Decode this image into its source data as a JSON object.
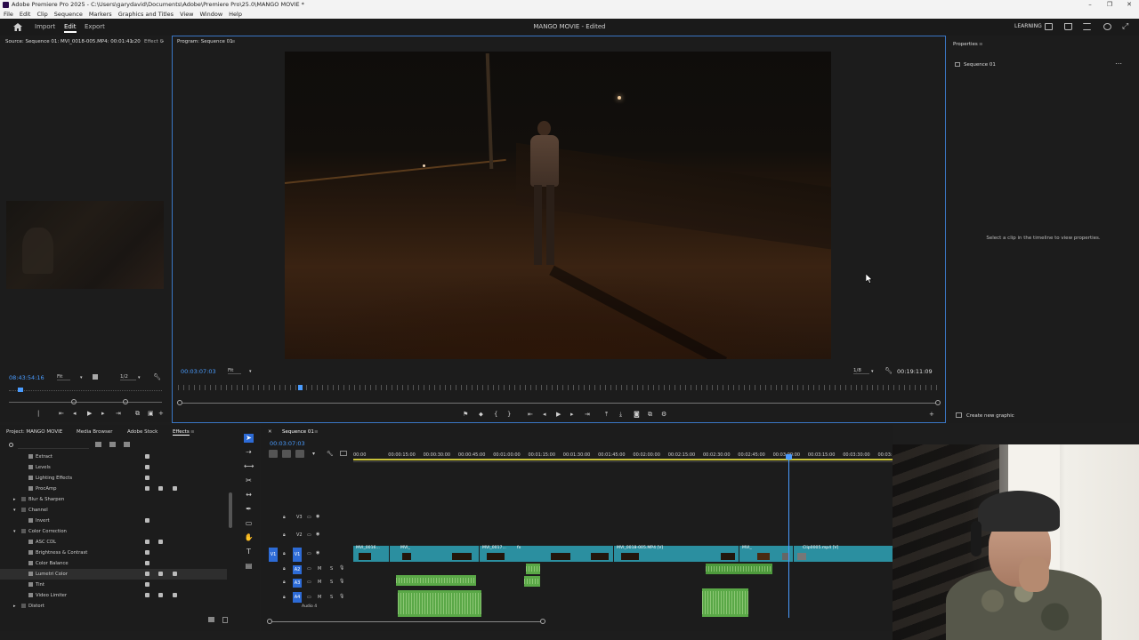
{
  "app": {
    "window_title": "Adobe Premiere Pro 2025 - C:\\Users\\garydavid\\Documents\\Adobe\\Premiere Pro\\25.0\\MANGO MOVIE *",
    "menus": [
      "File",
      "Edit",
      "Clip",
      "Sequence",
      "Markers",
      "Graphics and Titles",
      "View",
      "Window",
      "Help"
    ]
  },
  "header": {
    "tabs": [
      "Import",
      "Edit",
      "Export"
    ],
    "active_tab": "Edit",
    "project_title": "MANGO MOVIE - Edited",
    "workspace_label": "LEARNING"
  },
  "source": {
    "tab_label": "Source: Sequence 01: MVI_0018-005.MP4: 00:01:41:20",
    "tab2_label": "Effect C",
    "timecode": "08:43:54:16",
    "fit": "Fit",
    "resolution": "1/2"
  },
  "program": {
    "tab_label": "Program: Sequence 01",
    "timecode": "00:03:07:03",
    "fit": "Fit",
    "resolution": "1/8",
    "duration": "00:19:11:09"
  },
  "properties": {
    "tab_label": "Properties",
    "sequence": "Sequence 01",
    "hint": "Select a clip in the timeline to view properties.",
    "create_graphic": "Create new graphic"
  },
  "project_panel": {
    "tabs": [
      "Project: MANGO MOVIE",
      "Media Browser",
      "Adobe Stock",
      "Effects"
    ],
    "active_tab": "Effects",
    "tree": [
      {
        "label": "Extract",
        "depth": 2,
        "kind": "fx"
      },
      {
        "label": "Levels",
        "depth": 2,
        "kind": "fx"
      },
      {
        "label": "Lighting Effects",
        "depth": 2,
        "kind": "fx"
      },
      {
        "label": "ProcAmp",
        "depth": 2,
        "kind": "fx"
      },
      {
        "label": "Blur & Sharpen",
        "depth": 1,
        "kind": "folder"
      },
      {
        "label": "Channel",
        "depth": 1,
        "kind": "folder"
      },
      {
        "label": "Invert",
        "depth": 2,
        "kind": "fx"
      },
      {
        "label": "Color Correction",
        "depth": 1,
        "kind": "folder"
      },
      {
        "label": "ASC CDL",
        "depth": 2,
        "kind": "fx"
      },
      {
        "label": "Brightness & Contrast",
        "depth": 2,
        "kind": "fx"
      },
      {
        "label": "Color Balance",
        "depth": 2,
        "kind": "fx"
      },
      {
        "label": "Lumetri Color",
        "depth": 2,
        "kind": "fx",
        "selected": true
      },
      {
        "label": "Tint",
        "depth": 2,
        "kind": "fx"
      },
      {
        "label": "Video Limiter",
        "depth": 2,
        "kind": "fx"
      },
      {
        "label": "Distort",
        "depth": 1,
        "kind": "folder"
      }
    ]
  },
  "timeline": {
    "tab_label": "Sequence 01",
    "timecode": "00:03:07:03",
    "ruler": [
      "00:00",
      "00:00:15:00",
      "00:00:30:00",
      "00:00:45:00",
      "00:01:00:00",
      "00:01:15:00",
      "00:01:30:00",
      "00:01:45:00",
      "00:02:00:00",
      "00:02:15:00",
      "00:02:30:00",
      "00:02:45:00",
      "00:03:00:00",
      "00:03:15:00",
      "00:03:30:00",
      "00:03:45:00"
    ],
    "tracks": {
      "video": [
        "V3",
        "V2",
        "V1"
      ],
      "audio": [
        "A2",
        "A3",
        "A4"
      ],
      "audio_name": "Audio 4",
      "track_toggles": [
        "M",
        "S"
      ]
    },
    "clip_labels": [
      "MVI_0016...",
      "MVI_",
      "MVI_0017...",
      "MVI_0018-005.MP4 [V]",
      "MVI_",
      "Clip0005.mp4 [V]"
    ],
    "fx_label": "fx"
  },
  "colors": {
    "accent_blue": "#4a9cff",
    "video_clip": "#2b8fa0",
    "audio_clip": "#5aa847"
  }
}
